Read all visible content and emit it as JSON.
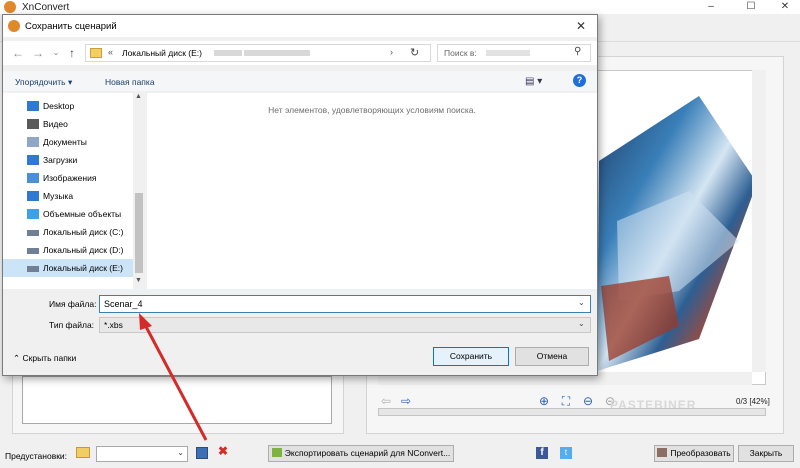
{
  "main": {
    "title": "XnConvert",
    "window_controls": [
      "–",
      "☐",
      "✕"
    ],
    "zoom_readout": "0/3 [42%]",
    "watermark": "PASTEBINER",
    "bottom": {
      "presets_label": "Предустановки:",
      "presets_value": "",
      "export_label": "Экспортировать сценарий для NConvert...",
      "convert_label": "Преобразовать",
      "close_label": "Закрыть"
    }
  },
  "dialog": {
    "title": "Сохранить сценарий",
    "close_glyph": "✕",
    "address": {
      "separator": "«",
      "drive": "Локальный диск (E:)",
      "chevron": "›"
    },
    "search_placeholder": "Поиск в:",
    "commands": {
      "organize": "Упорядочить ▾",
      "new_folder": "Новая папка"
    },
    "nav_items": [
      {
        "label": "Desktop",
        "icon": "desktop-icon",
        "color": "#2f78d4"
      },
      {
        "label": "Видео",
        "icon": "video-icon",
        "color": "#5a5a5a"
      },
      {
        "label": "Документы",
        "icon": "documents-icon",
        "color": "#8fa6c4"
      },
      {
        "label": "Загрузки",
        "icon": "downloads-icon",
        "color": "#2f78d4"
      },
      {
        "label": "Изображения",
        "icon": "pictures-icon",
        "color": "#4b8fd8"
      },
      {
        "label": "Музыка",
        "icon": "music-icon",
        "color": "#2f78d4"
      },
      {
        "label": "Объемные объекты",
        "icon": "3d-objects-icon",
        "color": "#3ba1e8"
      },
      {
        "label": "Локальный диск (C:)",
        "icon": "drive-c-icon",
        "color": "#6f7f95"
      },
      {
        "label": "Локальный диск (D:)",
        "icon": "drive-d-icon",
        "color": "#6f7f95"
      },
      {
        "label": "Локальный диск (E:)",
        "icon": "drive-e-icon",
        "color": "#6f7f95",
        "selected": true
      }
    ],
    "empty_message": "Нет элементов, удовлетворяющих условиям поиска.",
    "filename_label": "Имя файла:",
    "filename_value": "Scenar_4",
    "filetype_label": "Тип файла:",
    "filetype_value": "*.xbs",
    "hide_folders": "⌃ Скрыть папки",
    "save_label": "Сохранить",
    "cancel_label": "Отмена"
  }
}
